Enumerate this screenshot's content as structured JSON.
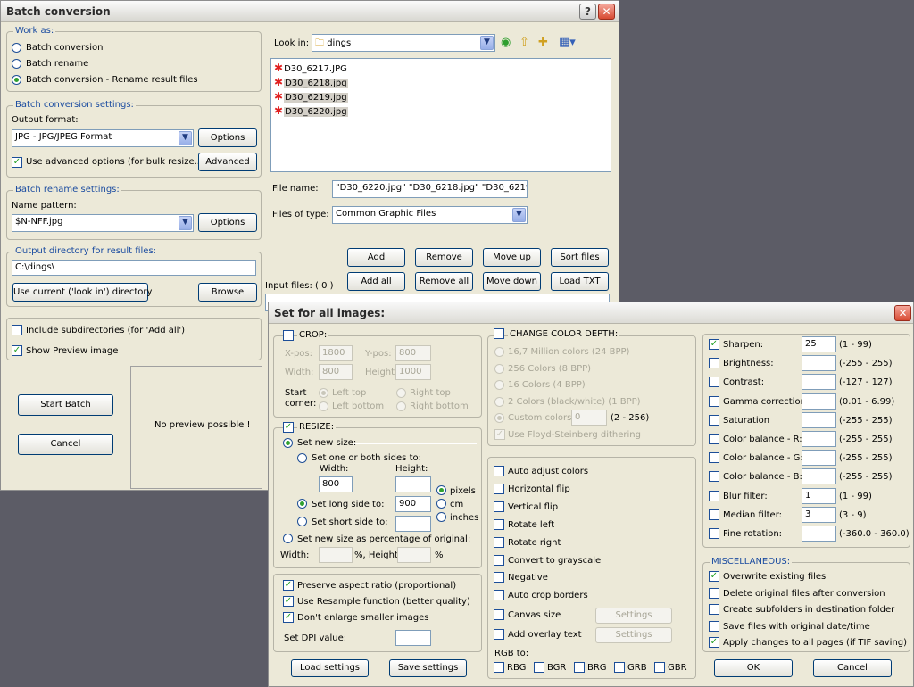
{
  "batch_window": {
    "title": "Batch conversion",
    "work_as": {
      "label": "Work as:",
      "options": [
        "Batch conversion",
        "Batch rename",
        "Batch conversion - Rename result files"
      ],
      "selected": 2
    },
    "conversion_settings": {
      "label": "Batch conversion settings:",
      "output_format_label": "Output format:",
      "output_format_value": "JPG - JPG/JPEG Format",
      "options_button": "Options",
      "advanced_checkbox": "Use advanced options (for bulk resize...)",
      "advanced_button": "Advanced"
    },
    "rename_settings": {
      "label": "Batch rename settings:",
      "name_pattern_label": "Name pattern:",
      "name_pattern_value": "$N-NFF.jpg",
      "options_button": "Options"
    },
    "output_dir": {
      "label": "Output directory for result files:",
      "value": "C:\\dings\\",
      "use_current_button": "Use current ('look in') directory",
      "browse_button": "Browse"
    },
    "include_subdirs": "Include subdirectories (for 'Add all')",
    "show_preview": "Show Preview image",
    "start_batch": "Start Batch",
    "cancel": "Cancel",
    "no_preview": "No preview possible !",
    "look_in_label": "Look in:",
    "look_in_value": "dings",
    "files": [
      "D30_6217.JPG",
      "D30_6218.jpg",
      "D30_6219.jpg",
      "D30_6220.jpg"
    ],
    "file_name_label": "File name:",
    "file_name_value": "\"D30_6220.jpg\" \"D30_6218.jpg\" \"D30_6219.jp",
    "files_of_type_label": "Files of type:",
    "files_of_type_value": "Common Graphic Files",
    "buttons": {
      "add": "Add",
      "remove": "Remove",
      "move_up": "Move up",
      "sort_files": "Sort files",
      "add_all": "Add all",
      "remove_all": "Remove all",
      "move_down": "Move down",
      "load_txt": "Load TXT"
    },
    "input_files_label": "Input files: ( 0 )"
  },
  "set_window": {
    "title": "Set for all images:",
    "crop": {
      "label": "CROP:",
      "xpos_label": "X-pos:",
      "xpos": "1800",
      "ypos_label": "Y-pos:",
      "ypos": "800",
      "width_label": "Width:",
      "width": "800",
      "height_label": "Height:",
      "height": "1000",
      "start_label_1": "Start",
      "start_label_2": "corner:",
      "corners": [
        "Left top",
        "Right top",
        "Left bottom",
        "Right bottom"
      ]
    },
    "resize": {
      "label": "RESIZE:",
      "set_new_size": "Set new size:",
      "set_one_or_both": "Set one or both sides to:",
      "width_label": "Width:",
      "width_value": "800",
      "height_label": "Height:",
      "height_value": "",
      "long_side": "Set long side to:",
      "long_side_value": "900",
      "short_side": "Set short side to:",
      "short_side_value": "",
      "units": [
        "pixels",
        "cm",
        "inches"
      ],
      "percentage": "Set new size as percentage of original:",
      "pct_width_label": "Width:",
      "pct_height_label": "%, Height:",
      "pct_suffix": "%"
    },
    "options": {
      "preserve": "Preserve aspect ratio (proportional)",
      "resample": "Use Resample function (better quality)",
      "dont_enlarge": "Don't enlarge smaller images",
      "dpi_label": "Set DPI value:"
    },
    "load_settings": "Load settings",
    "save_settings": "Save settings",
    "color_depth": {
      "label": "CHANGE COLOR DEPTH:",
      "options": [
        "16,7 Million colors (24 BPP)",
        "256 Colors (8 BPP)",
        "16 Colors (4 BPP)",
        "2 Colors (black/white) (1 BPP)"
      ],
      "custom": "Custom colors:",
      "custom_value": "0",
      "custom_range": "(2 - 256)",
      "dithering": "Use Floyd-Steinberg dithering"
    },
    "transforms": [
      "Auto adjust colors",
      "Horizontal flip",
      "Vertical flip",
      "Rotate left",
      "Rotate right",
      "Convert to grayscale",
      "Negative",
      "Auto crop borders"
    ],
    "canvas_size": "Canvas size",
    "overlay_text": "Add overlay text",
    "settings_button": "Settings",
    "rgb_label": "RGB to:",
    "rgb_options": [
      "RBG",
      "BGR",
      "BRG",
      "GRB",
      "GBR"
    ],
    "filters": [
      {
        "label": "Sharpen:",
        "value": "25",
        "range": "(1  -  99)",
        "checked": true
      },
      {
        "label": "Brightness:",
        "value": "",
        "range": "(-255  -  255)",
        "checked": false
      },
      {
        "label": "Contrast:",
        "value": "",
        "range": "(-127  -  127)",
        "checked": false
      },
      {
        "label": "Gamma correction:",
        "value": "",
        "range": "(0.01  -  6.99)",
        "checked": false
      },
      {
        "label": "Saturation",
        "value": "",
        "range": "(-255  -  255)",
        "checked": false
      },
      {
        "label": "Color balance - R:",
        "value": "",
        "range": "(-255  -  255)",
        "checked": false
      },
      {
        "label": "Color balance - G:",
        "value": "",
        "range": "(-255  -  255)",
        "checked": false
      },
      {
        "label": "Color balance - B:",
        "value": "",
        "range": "(-255  -  255)",
        "checked": false
      },
      {
        "label": "Blur filter:",
        "value": "1",
        "range": "(1  -  99)",
        "checked": false
      },
      {
        "label": "Median filter:",
        "value": "3",
        "range": "(3  -  9)",
        "checked": false
      },
      {
        "label": "Fine rotation:",
        "value": "",
        "range": "(-360.0  -  360.0)",
        "checked": false
      }
    ],
    "misc": {
      "label": "MISCELLANEOUS:",
      "items": [
        {
          "label": "Overwrite existing files",
          "checked": true
        },
        {
          "label": "Delete original files after conversion",
          "checked": false
        },
        {
          "label": "Create subfolders in destination folder",
          "checked": false
        },
        {
          "label": "Save files with original date/time",
          "checked": false
        },
        {
          "label": "Apply changes to all pages (if TIF saving)",
          "checked": true
        }
      ]
    },
    "ok": "OK",
    "cancel": "Cancel"
  },
  "colors": {
    "accent": "#1b4ca0",
    "dialog_bg": "#ece9d8",
    "desktop": "#5c5c66"
  }
}
